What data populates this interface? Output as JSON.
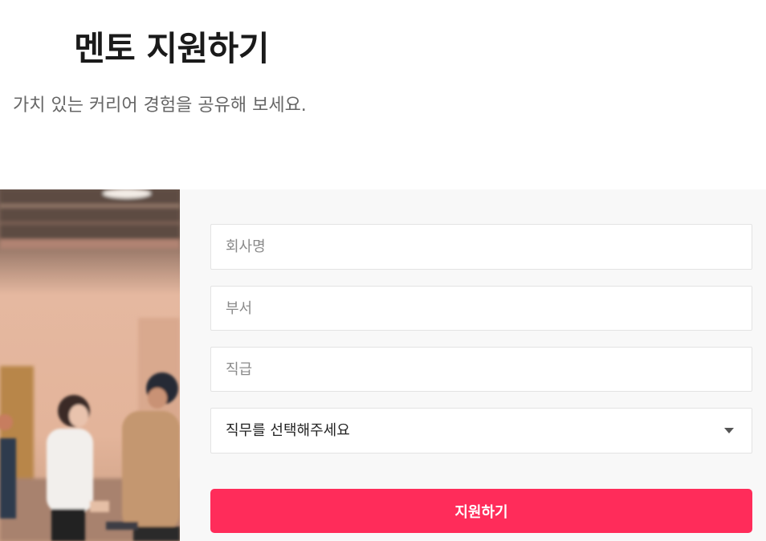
{
  "header": {
    "title": "멘토 지원하기",
    "subtitle": "가치 있는 커리어 경험을 공유해 보세요."
  },
  "form": {
    "company_placeholder": "회사명",
    "department_placeholder": "부서",
    "rank_placeholder": "직급",
    "job_select": {
      "selected": "직무를 선택해주세요",
      "icon": "chevron-down-icon"
    },
    "submit_label": "지원하기"
  },
  "colors": {
    "accent": "#ff2c5a",
    "form_background": "#f8f8f8"
  }
}
